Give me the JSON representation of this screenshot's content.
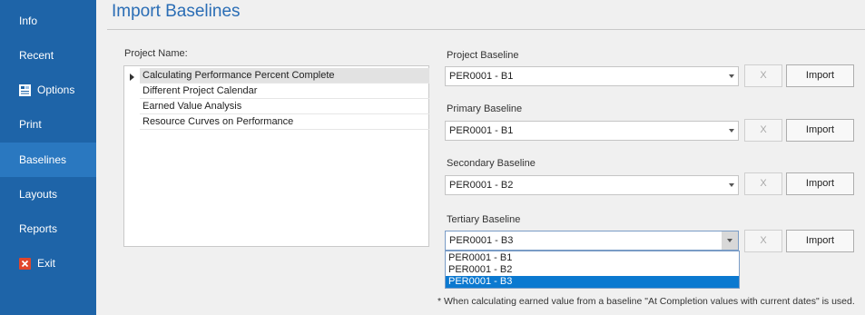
{
  "sidebar": {
    "items": [
      {
        "label": "Info",
        "icon": ""
      },
      {
        "label": "Recent",
        "icon": ""
      },
      {
        "label": "Options",
        "icon": "options-icon"
      },
      {
        "label": "Print",
        "icon": ""
      },
      {
        "label": "Baselines",
        "icon": "",
        "active": true
      },
      {
        "label": "Layouts",
        "icon": ""
      },
      {
        "label": "Reports",
        "icon": ""
      },
      {
        "label": "Exit",
        "icon": "exit-icon"
      }
    ]
  },
  "main": {
    "title": "Import Baselines",
    "project_label": "Project Name:",
    "projects": [
      "Calculating Performance Percent Complete",
      "Different Project Calendar",
      "Earned Value Analysis",
      "Resource Curves on Performance"
    ],
    "baselines": [
      {
        "label": "Project Baseline",
        "value": "PER0001 - B1",
        "clear_label": "X",
        "import_label": "Import"
      },
      {
        "label": "Primary Baseline",
        "value": "PER0001 - B1",
        "clear_label": "X",
        "import_label": "Import"
      },
      {
        "label": "Secondary Baseline",
        "value": "PER0001 - B2",
        "clear_label": "X",
        "import_label": "Import"
      },
      {
        "label": "Tertiary Baseline",
        "value": "PER0001 - B3",
        "clear_label": "X",
        "import_label": "Import"
      }
    ],
    "dropdown_options": [
      "PER0001 - B1",
      "PER0001 - B2",
      "PER0001 - B3"
    ],
    "footnote": "* When calculating earned value from a baseline \"At Completion values with current dates\" is used."
  },
  "colors": {
    "sidebar_bg": "#1e64a8",
    "sidebar_active": "#2a78c0",
    "title": "#2a6db5",
    "selection": "#0b79d0"
  }
}
